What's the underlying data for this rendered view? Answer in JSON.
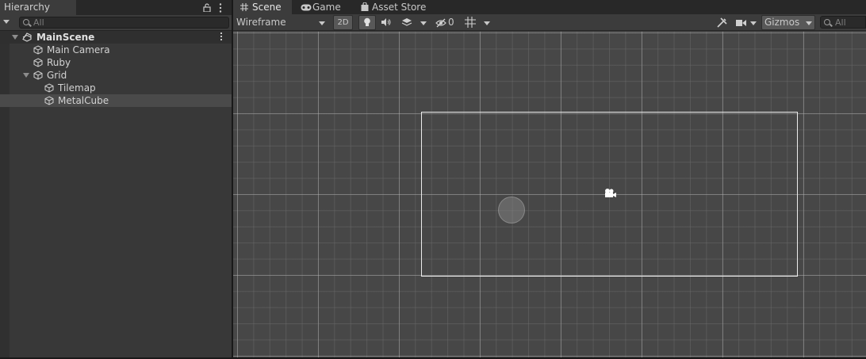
{
  "hierarchy": {
    "tab_title": "Hierarchy",
    "search_placeholder": "All",
    "tree": [
      {
        "label": "MainScene",
        "kind": "scene"
      },
      {
        "label": "Main Camera",
        "kind": "object"
      },
      {
        "label": "Ruby",
        "kind": "object"
      },
      {
        "label": "Grid",
        "kind": "object"
      },
      {
        "label": "Tilemap",
        "kind": "object"
      },
      {
        "label": "MetalCube",
        "kind": "object",
        "selected": true
      }
    ]
  },
  "scene": {
    "tabs": [
      {
        "label": "Scene",
        "icon": "grid-icon",
        "active": true
      },
      {
        "label": "Game",
        "icon": "gamepad-icon",
        "active": false
      },
      {
        "label": "Asset Store",
        "icon": "shopping-bag-icon",
        "active": false
      }
    ],
    "toolbar": {
      "draw_mode": "Wireframe",
      "mode_2d": "2D",
      "hidden_count": "0",
      "gizmos_label": "Gizmos",
      "search_placeholder": "All"
    }
  },
  "colors": {
    "panel_bg": "#383838",
    "viewport_bg": "#474747",
    "selection_bg": "#4a4a4a",
    "camera_frame": "#ececec"
  }
}
